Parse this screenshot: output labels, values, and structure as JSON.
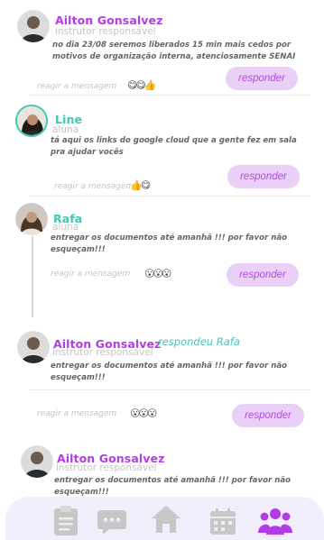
{
  "messages": [
    {
      "author": "Ailton Gonsalvez",
      "role": "instrutor responsável",
      "text_lines": [
        "no dia 23/08 seremos liberados  15 min mais cedos por",
        "motivos de organização interna, atenciosamente SENAI"
      ],
      "react_label": "reagir a mensagem",
      "emojis": "😋😋👍",
      "reply_label": "responder"
    },
    {
      "author": "Line",
      "role": "aluna",
      "text_lines": [
        "tá aqui os links do google cloud que a gente fez em sala",
        "pra ajudar vocês"
      ],
      "react_label": "reagir a mensagem",
      "emojis": "👍😋",
      "reply_label": "responder"
    },
    {
      "author": "Rafa",
      "role": "aluna",
      "text_lines": [
        "entregar os documentos até amanhã !!! por favor não",
        "esqueçam!!!"
      ],
      "react_label": "reagir a mensagem",
      "emojis": "😮😮😮",
      "reply_label": "responder"
    },
    {
      "author": "Ailton Gonsalvez",
      "replied_to": "respondeu Rafa",
      "role": "instrutor responsável",
      "text_lines": [
        "entregar os documentos até amanhã !!! por favor não",
        "esqueçam!!!"
      ],
      "react_label": "reagir a mensagem",
      "emojis": "😮😮😮",
      "reply_label": "responder"
    },
    {
      "author": "Ailton Gonsalvez",
      "role": "instrutor responsável",
      "text_lines": [
        "entregar os documentos até amanhã !!! por favor não",
        "esqueçam!!!"
      ]
    }
  ],
  "nav": {
    "items": [
      "clipboard-icon",
      "chat-icon",
      "home-icon",
      "calendar-icon",
      "group-icon"
    ],
    "active": "group-icon"
  },
  "colors": {
    "accent": "#b23de6",
    "teal": "#3fc9b4",
    "button_bg": "#ead0f6",
    "nav_bg": "#f2eefc",
    "nav_icon": "#c7c7c7"
  }
}
